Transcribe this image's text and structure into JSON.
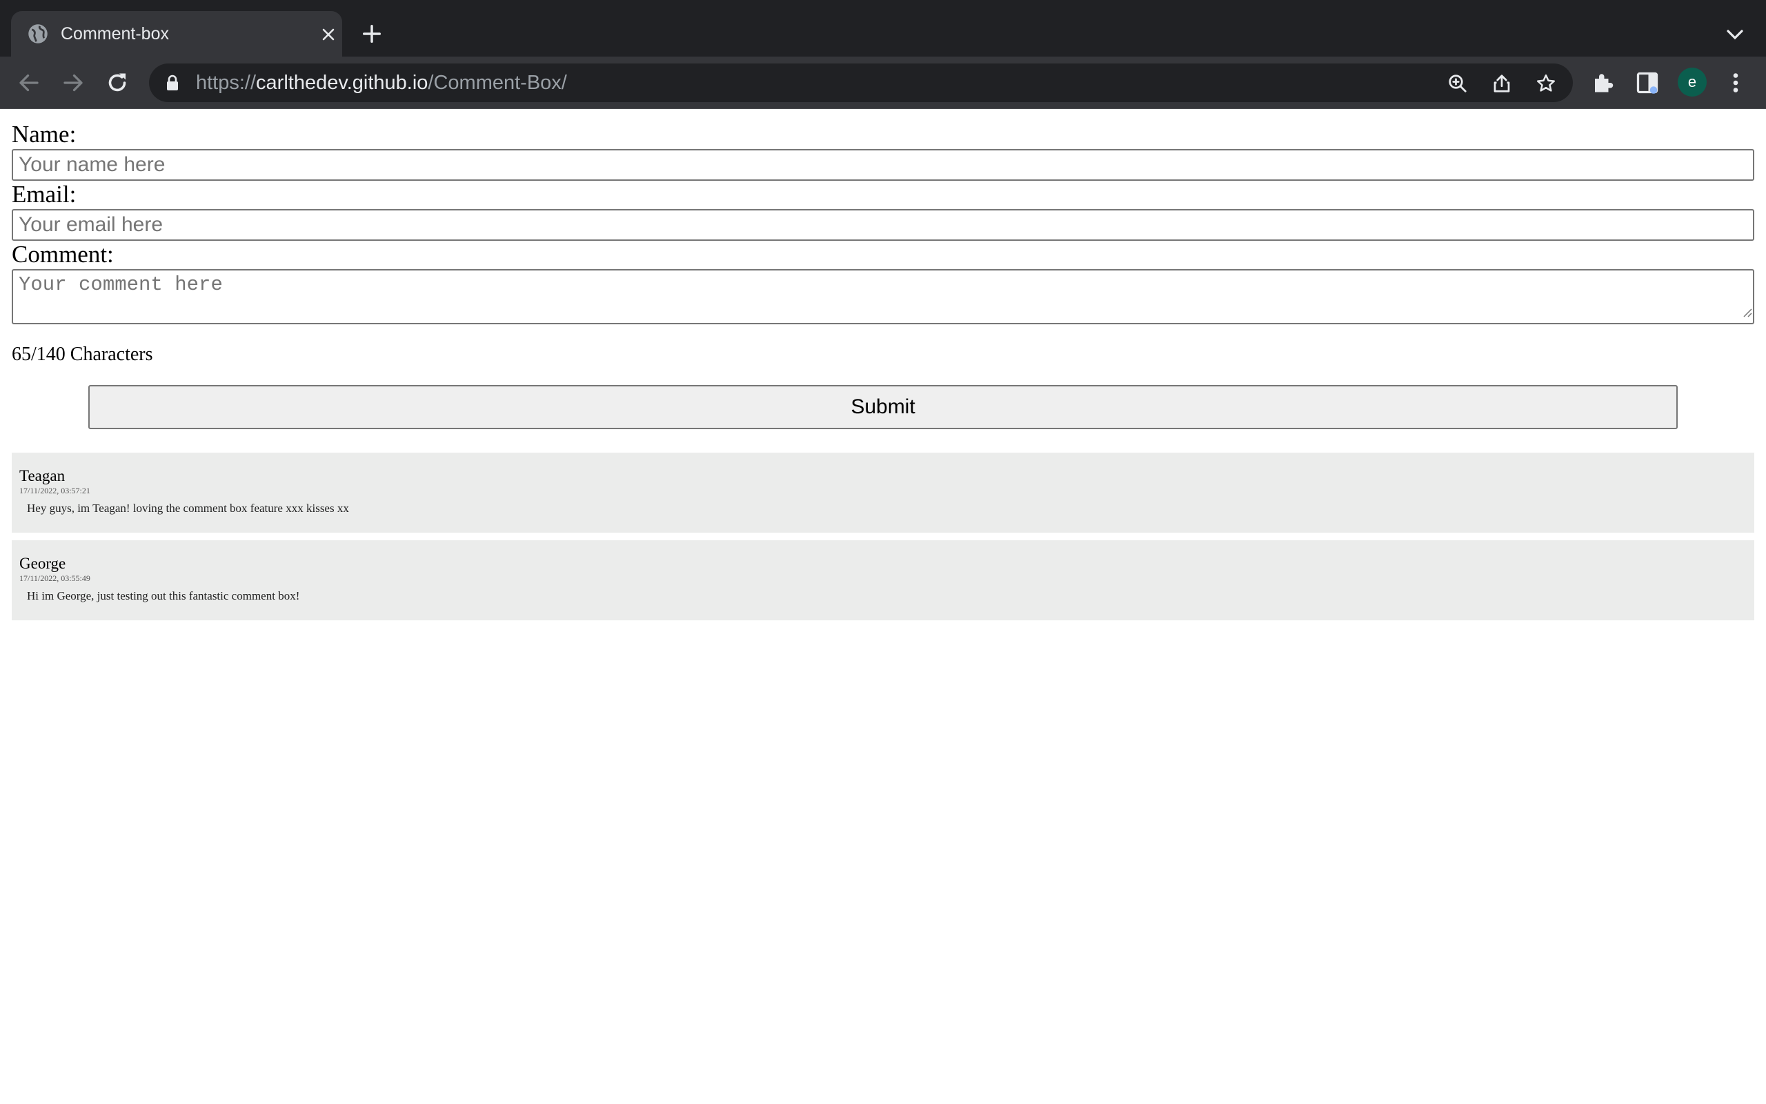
{
  "browser": {
    "tab_title": "Comment-box",
    "url_scheme": "https://",
    "url_host": "carlthedev.github.io",
    "url_path": "/Comment-Box/",
    "profile_initial": "e"
  },
  "form": {
    "name_label": "Name:",
    "name_placeholder": "Your name here",
    "email_label": "Email:",
    "email_placeholder": "Your email here",
    "comment_label": "Comment:",
    "comment_placeholder": "Your comment here",
    "counter": "65/140 Characters",
    "submit_label": "Submit"
  },
  "comments": [
    {
      "name": "Teagan",
      "timestamp": "17/11/2022, 03:57:21",
      "text": "Hey guys, im Teagan! loving the comment box feature xxx kisses xx"
    },
    {
      "name": "George",
      "timestamp": "17/11/2022, 03:55:49",
      "text": "Hi im George, just testing out this fantastic comment box!"
    }
  ]
}
